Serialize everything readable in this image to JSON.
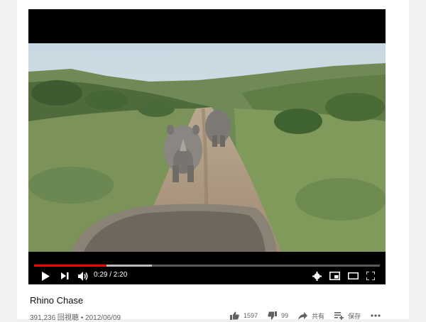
{
  "video": {
    "title": "Rhino Chase",
    "views": "391,236 回視聴",
    "separator": "•",
    "date": "2012/06/09"
  },
  "player": {
    "current_time": "0:29",
    "duration": "2:20",
    "time_display": "0:29 / 2:20",
    "progress_fraction": 0.21,
    "buffered_fraction": 0.34
  },
  "actions": {
    "likes": "1597",
    "dislikes": "99",
    "share_label": "共有",
    "save_label": "保存"
  },
  "icons": [
    "play-icon",
    "next-icon",
    "volume-icon",
    "settings-icon",
    "miniplayer-icon",
    "theater-icon",
    "fullscreen-icon",
    "like-icon",
    "dislike-icon",
    "share-icon",
    "save-icon",
    "more-icon"
  ],
  "colors": {
    "progress": "#ff0000",
    "accent_text": "#606060"
  }
}
